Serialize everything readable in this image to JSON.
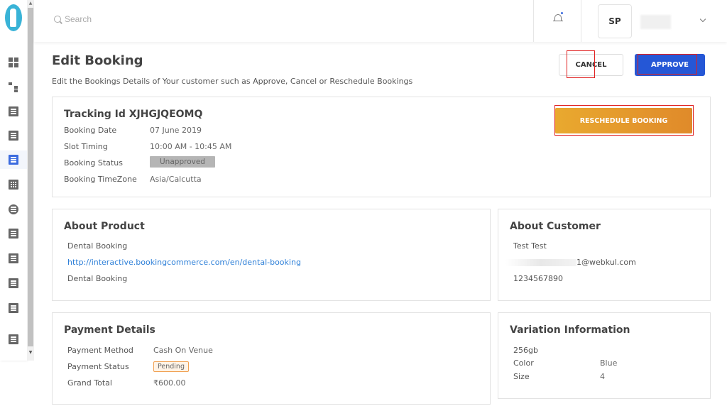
{
  "sidebar": {
    "logo": "dental-tooth-logo",
    "items": [
      {
        "name": "dashboard",
        "icon": "dashboard-icon",
        "active": false
      },
      {
        "name": "hierarchy",
        "icon": "hierarchy-icon",
        "active": false
      },
      {
        "name": "calendar",
        "icon": "calendar-icon",
        "active": false
      },
      {
        "name": "list",
        "icon": "list-icon",
        "active": false
      },
      {
        "name": "bookings",
        "icon": "bookings-icon",
        "active": true
      },
      {
        "name": "grid",
        "icon": "grid-icon",
        "active": false
      },
      {
        "name": "customers",
        "icon": "user-icon",
        "active": false
      },
      {
        "name": "reviews",
        "icon": "star-icon",
        "active": false
      },
      {
        "name": "groups",
        "icon": "group-icon",
        "active": false
      },
      {
        "name": "plugins",
        "icon": "puzzle-icon",
        "active": false
      },
      {
        "name": "settings",
        "icon": "gear-icon",
        "active": false
      },
      {
        "name": "import",
        "icon": "download-icon",
        "active": false
      }
    ]
  },
  "topbar": {
    "search_placeholder": "Search",
    "avatar_initials": "SP"
  },
  "header": {
    "title": "Edit Booking",
    "subtitle": "Edit the Bookings Details of Your customer such as Approve, Cancel or Reschedule Bookings",
    "cancel_label": "CANCEL",
    "approve_label": "APPROVE"
  },
  "booking": {
    "tracking_prefix": "Tracking Id",
    "tracking_id": "XJHGJQEOMQ",
    "reschedule_label": "RESCHEDULE BOOKING",
    "fields": [
      {
        "label": "Booking Date",
        "value": "07 June 2019"
      },
      {
        "label": "Slot Timing",
        "value": "10:00 AM - 10:45 AM"
      },
      {
        "label": "Booking Status",
        "value": "Unapproved"
      },
      {
        "label": "Booking TimeZone",
        "value": "Asia/Calcutta"
      }
    ]
  },
  "product": {
    "title": "About Product",
    "name": "Dental Booking",
    "url": "http://interactive.bookingcommerce.com/en/dental-booking",
    "description": "Dental Booking"
  },
  "customer": {
    "title": "About Customer",
    "name": "Test Test",
    "email_visible": "1@webkul.com",
    "phone": "1234567890"
  },
  "payment": {
    "title": "Payment Details",
    "fields": [
      {
        "label": "Payment Method",
        "value": "Cash On Venue"
      },
      {
        "label": "Payment Status",
        "value": "Pending"
      },
      {
        "label": "Grand Total",
        "value": "₹600.00"
      }
    ]
  },
  "variation": {
    "title": "Variation Information",
    "header": "256gb",
    "fields": [
      {
        "label": "Color",
        "value": "Blue"
      },
      {
        "label": "Size",
        "value": "4"
      }
    ]
  },
  "colors": {
    "primary": "#2557d6",
    "reschedule_start": "#e9a92f",
    "reschedule_end": "#e08a2a",
    "link": "#2f80d8",
    "pending": "#f0982f",
    "logo": "#39b3d7"
  }
}
